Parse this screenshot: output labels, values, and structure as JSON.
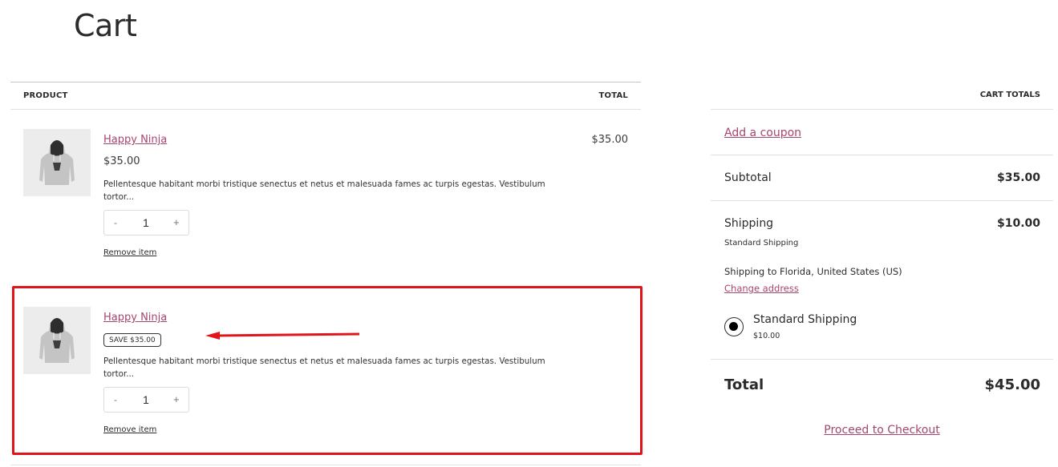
{
  "page": {
    "title": "Cart"
  },
  "cart_table": {
    "headers": {
      "product": "PRODUCT",
      "total": "TOTAL"
    },
    "items": [
      {
        "name": "Happy Ninja",
        "price": "$35.00",
        "badge": null,
        "description": "Pellentesque habitant morbi tristique senectus et netus et malesuada fames ac turpis egestas. Vestibulum tortor...",
        "quantity": "1",
        "qty_minus": "-",
        "qty_plus": "+",
        "remove_label": "Remove item",
        "line_total": "$35.00"
      },
      {
        "name": "Happy Ninja",
        "price": null,
        "badge": "SAVE $35.00",
        "description": "Pellentesque habitant morbi tristique senectus et netus et malesuada fames ac turpis egestas. Vestibulum tortor...",
        "quantity": "1",
        "qty_minus": "-",
        "qty_plus": "+",
        "remove_label": "Remove item",
        "line_total": ""
      }
    ]
  },
  "totals": {
    "title": "CART TOTALS",
    "coupon_link": "Add a coupon",
    "subtotal_label": "Subtotal",
    "subtotal_value": "$35.00",
    "shipping_label": "Shipping",
    "shipping_value": "$10.00",
    "shipping_method": "Standard Shipping",
    "shipping_destination": "Shipping to Florida, United States (US)",
    "change_address": "Change address",
    "shipping_option": {
      "label": "Standard Shipping",
      "price": "$10.00",
      "selected": true
    },
    "total_label": "Total",
    "total_value": "$45.00",
    "checkout_label": "Proceed to Checkout"
  },
  "annotation": {
    "highlight_color": "#e0141b",
    "link_color": "#a5466f"
  }
}
